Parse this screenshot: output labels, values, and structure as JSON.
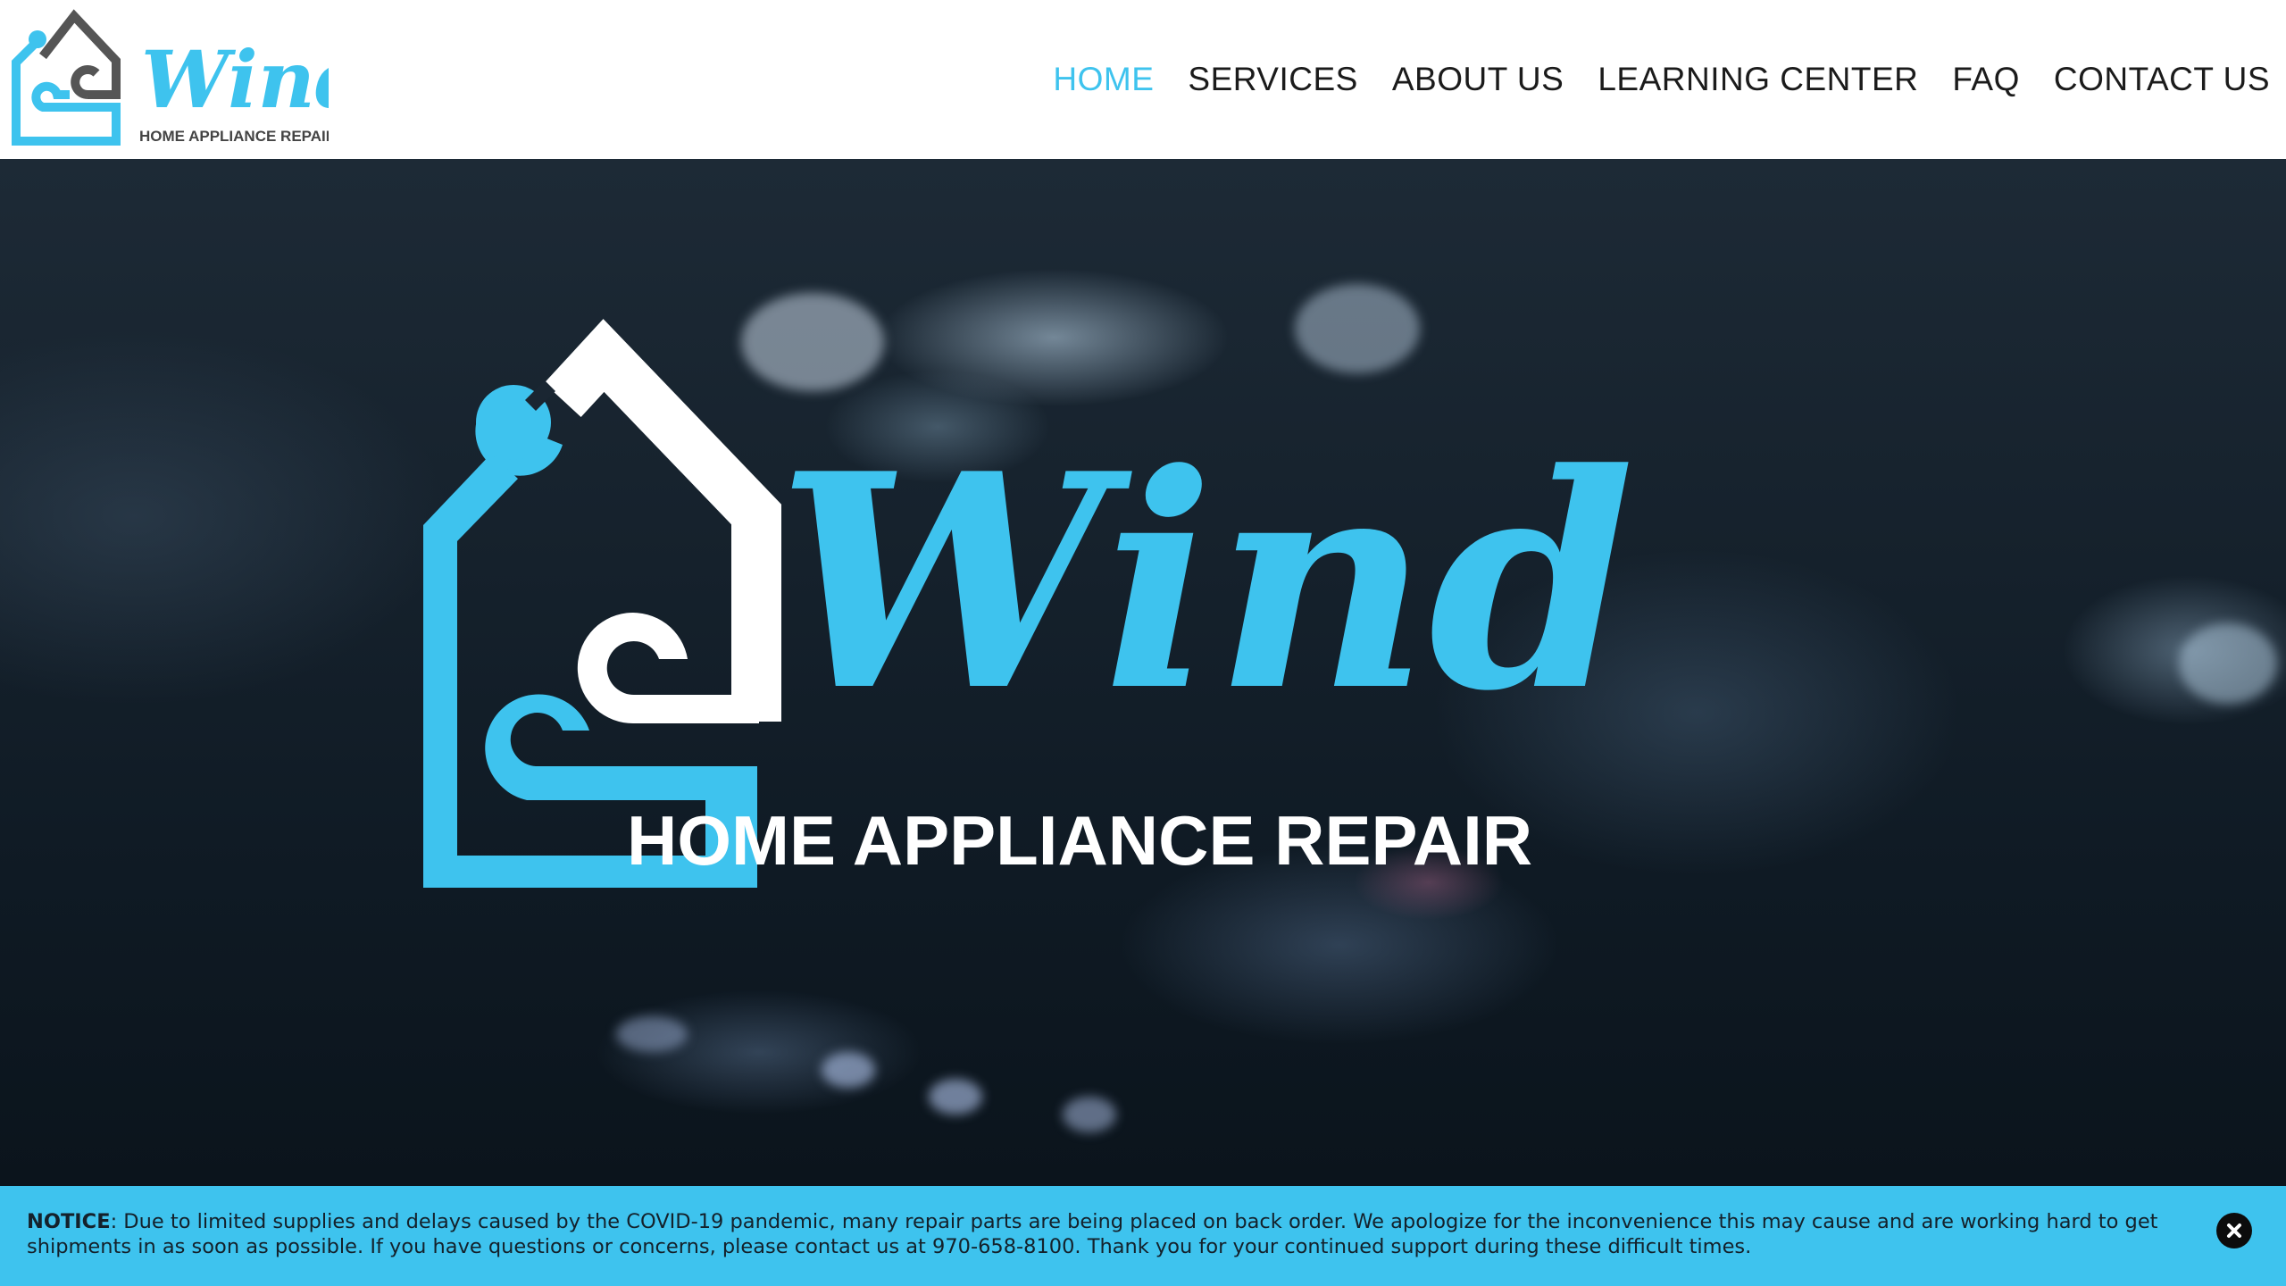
{
  "brand": {
    "name": "Wind",
    "tagline": "HOME APPLIANCE REPAIR",
    "accent_color": "#3ec3ee",
    "mark_color": "#ffffff",
    "small_mark_color": "#555555"
  },
  "nav": {
    "items": [
      {
        "label": "HOME",
        "active": true
      },
      {
        "label": "SERVICES",
        "active": false
      },
      {
        "label": "ABOUT US",
        "active": false
      },
      {
        "label": "LEARNING CENTER",
        "active": false
      },
      {
        "label": "FAQ",
        "active": false
      },
      {
        "label": "CONTACT US",
        "active": false
      }
    ]
  },
  "hero": {
    "logo_name": "Wind",
    "logo_tagline": "HOME APPLIANCE REPAIR",
    "background": "stove-burner-photo"
  },
  "notice": {
    "label": "NOTICE",
    "text": ": Due to limited supplies and delays caused by the COVID-19 pandemic, many repair parts are being placed on back order. We apologize for the inconvenience this may cause and are working hard to get shipments in as soon as possible. If you have questions or concerns, please contact us at 970-658-8100. Thank you for your continued support during these difficult times.",
    "close_icon": "close-circle-icon"
  }
}
